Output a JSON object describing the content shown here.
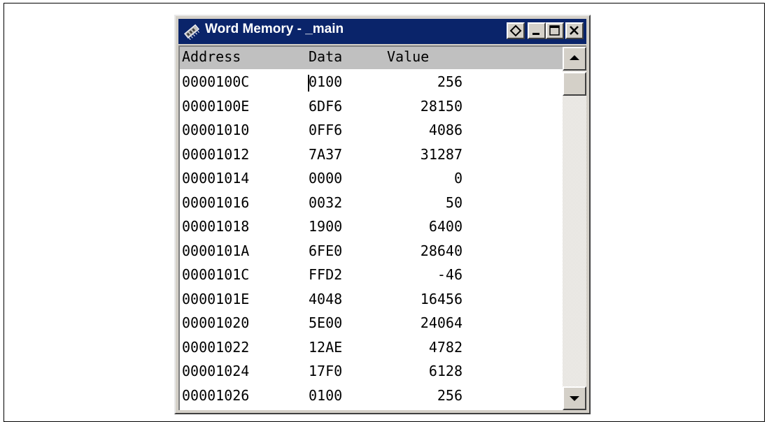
{
  "window": {
    "title": "Word Memory - _main"
  },
  "columns": {
    "address": "Address",
    "data": "Data",
    "value": "Value"
  },
  "rows": [
    {
      "address": "0000100C",
      "data": "0100",
      "value": "256"
    },
    {
      "address": "0000100E",
      "data": "6DF6",
      "value": "28150"
    },
    {
      "address": "00001010",
      "data": "0FF6",
      "value": "4086"
    },
    {
      "address": "00001012",
      "data": "7A37",
      "value": "31287"
    },
    {
      "address": "00001014",
      "data": "0000",
      "value": "0"
    },
    {
      "address": "00001016",
      "data": "0032",
      "value": "50"
    },
    {
      "address": "00001018",
      "data": "1900",
      "value": "6400"
    },
    {
      "address": "0000101A",
      "data": "6FE0",
      "value": "28640"
    },
    {
      "address": "0000101C",
      "data": "FFD2",
      "value": "-46"
    },
    {
      "address": "0000101E",
      "data": "4048",
      "value": "16456"
    },
    {
      "address": "00001020",
      "data": "5E00",
      "value": "24064"
    },
    {
      "address": "00001022",
      "data": "12AE",
      "value": "4782"
    },
    {
      "address": "00001024",
      "data": "17F0",
      "value": "6128"
    },
    {
      "address": "00001026",
      "data": "0100",
      "value": "256"
    }
  ],
  "icons": {
    "window_icon": "memory-icon",
    "display_mode": "display-mode-icon",
    "minimize": "minimize-icon",
    "maximize": "maximize-icon",
    "close": "close-icon",
    "scroll_up": "scroll-up-arrow-icon",
    "scroll_down": "scroll-down-arrow-icon"
  },
  "colors": {
    "titlebar": "#0a246a",
    "header": "#c0c0c0",
    "face": "#d4d0c8"
  }
}
